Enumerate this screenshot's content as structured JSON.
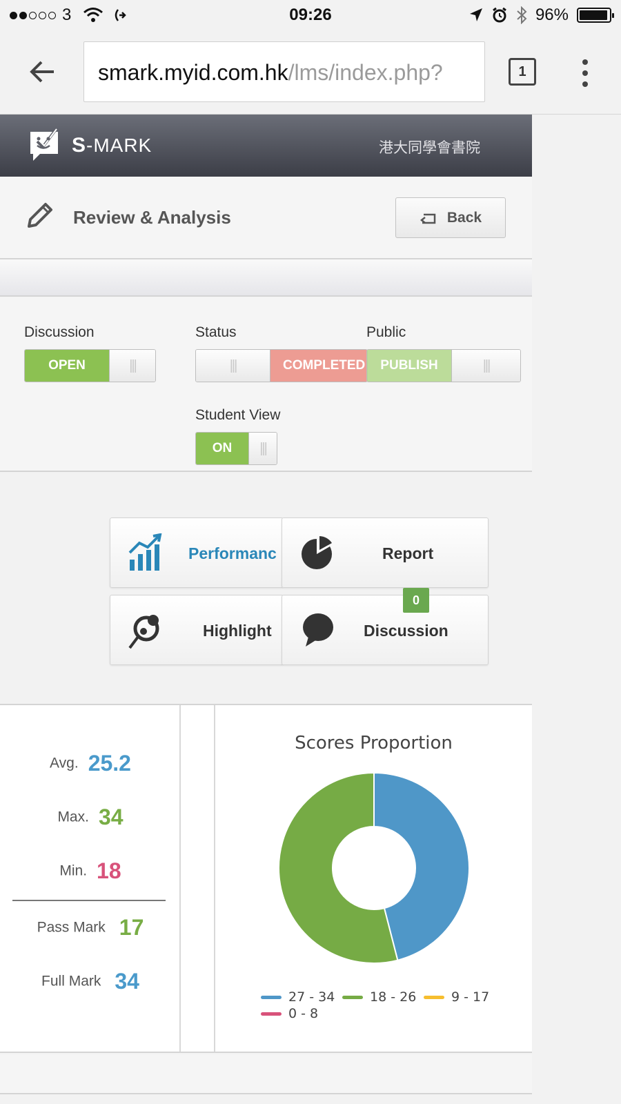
{
  "status_bar": {
    "carrier": "3",
    "time": "09:26",
    "battery": "96%",
    "battery_level": 0.96
  },
  "browser": {
    "url_host": "smark.myid.com.hk",
    "url_path": "/lms/index.php?",
    "tab_count": "1"
  },
  "app": {
    "logo_bold": "S",
    "logo_text": "-MARK",
    "school_name": "港大同學會書院"
  },
  "page": {
    "title": "Review & Analysis",
    "back_label": "Back"
  },
  "toggles": {
    "discussion": {
      "label": "Discussion",
      "value": "OPEN",
      "color": "#8cc152"
    },
    "status": {
      "label": "Status",
      "value": "COMPLETED",
      "color": "#ed9c93"
    },
    "public": {
      "label": "Public",
      "value": "PUBLISH",
      "color": "#b4d98e"
    },
    "student_view": {
      "label": "Student View",
      "value": "ON",
      "color": "#8cc152"
    },
    "grip": "|||"
  },
  "menu": {
    "performance": "Performanc",
    "report": "Report",
    "highlight": "Highlight",
    "discussion": "Discussion",
    "discussion_badge": "0",
    "accent": "#2a87b8"
  },
  "stats": {
    "avg_label": "Avg.",
    "avg_value": "25.2",
    "max_label": "Max.",
    "max_value": "34",
    "min_label": "Min.",
    "min_value": "18",
    "pass_label": "Pass Mark",
    "pass_value": "17",
    "full_label": "Full Mark",
    "full_value": "34",
    "colors": {
      "blue": "#4a9acb",
      "green": "#78ad45",
      "red": "#d8527a"
    }
  },
  "chart_data": {
    "type": "pie",
    "title": "Scores Proportion",
    "categories": [
      "27 - 34",
      "18 - 26",
      "9 - 17",
      "0 - 8"
    ],
    "values": [
      46,
      54,
      0,
      0
    ],
    "colors": [
      "#4f97c8",
      "#76ab45",
      "#f6be2f",
      "#d8527a"
    ],
    "donut": true,
    "legend_position": "bottom"
  }
}
